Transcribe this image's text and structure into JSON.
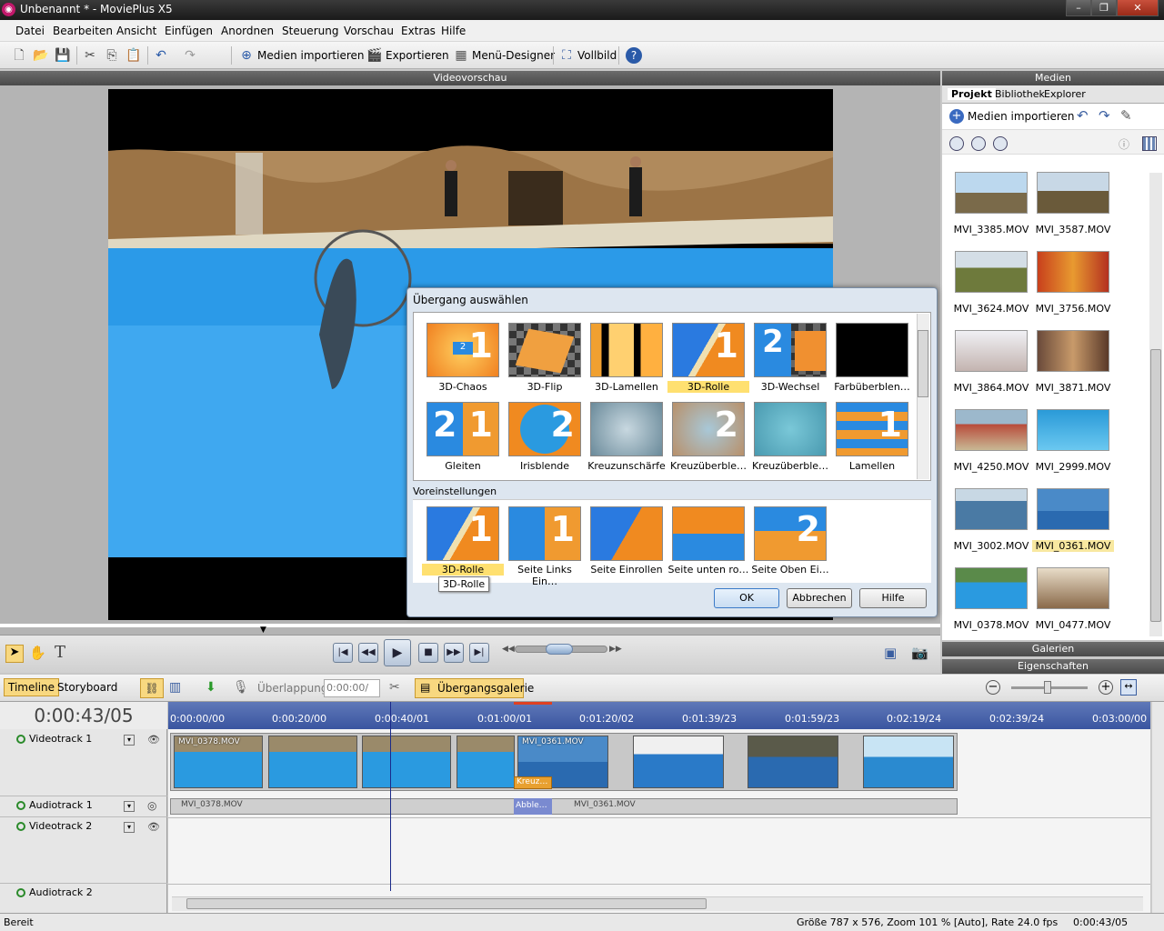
{
  "window": {
    "title": "Unbenannt * - MoviePlus X5"
  },
  "menu": [
    "Datei",
    "Bearbeiten",
    "Ansicht",
    "Einfügen",
    "Anordnen",
    "Steuerung",
    "Vorschau",
    "Extras",
    "Hilfe"
  ],
  "toolbar": {
    "import": "Medien importieren",
    "export": "Exportieren",
    "menu_designer": "Menü-Designer",
    "fullscreen": "Vollbild"
  },
  "preview": {
    "header": "Videovorschau"
  },
  "media": {
    "header": "Medien",
    "tabs": [
      "Projekt",
      "Bibliothek",
      "Explorer"
    ],
    "import": "Medien importieren",
    "items": [
      "MVI_3385.MOV",
      "MVI_3587.MOV",
      "MVI_3624.MOV",
      "MVI_3756.MOV",
      "MVI_3864.MOV",
      "MVI_3871.MOV",
      "MVI_4250.MOV",
      "MVI_2999.MOV",
      "MVI_3002.MOV",
      "MVI_0361.MOV",
      "MVI_0378.MOV",
      "MVI_0477.MOV"
    ],
    "galleries": "Galerien",
    "properties": "Eigenschaften"
  },
  "dialog": {
    "title": "Übergang auswählen",
    "transitions": [
      "3D-Chaos",
      "3D-Flip",
      "3D-Lamellen",
      "3D-Rolle",
      "3D-Wechsel",
      "Farbüberblen…",
      "Gleiten",
      "Irisblende",
      "Kreuzunschärfe",
      "Kreuzüberble…",
      "Kreuzüberble…",
      "Lamellen"
    ],
    "presets_header": "Voreinstellungen",
    "presets": [
      "3D-Rolle",
      "Seite Links Ein…",
      "Seite Einrollen",
      "Seite unten ro…",
      "Seite Oben Ei…"
    ],
    "tooltip": "3D-Rolle",
    "ok": "OK",
    "cancel": "Abbrechen",
    "help": "Hilfe"
  },
  "timeline": {
    "tab_timeline": "Timeline",
    "tab_storyboard": "Storyboard",
    "overlap_label": "Überlappung",
    "overlap_value": "0:00:00/",
    "gallery": "Übergangsgalerie",
    "current_time": "0:00:43/05",
    "ruler": [
      "0:00:00/00",
      "0:00:20/00",
      "0:00:40/01",
      "0:01:00/01",
      "0:01:20/02",
      "0:01:39/23",
      "0:01:59/23",
      "0:02:19/24",
      "0:02:39/24",
      "0:03:00/00"
    ],
    "tracks": [
      "Videotrack 1",
      "Audiotrack 1",
      "Videotrack 2",
      "Audiotrack 2"
    ],
    "video_clip_1": "MVI_0378.MOV",
    "video_clip_2": "MVI_0361.MOV",
    "transition_short": "Kreuz…",
    "audio_clip_1": "MVI_0378.MOV",
    "audio_transition": "Abble…",
    "audio_clip_2": "MVI_0361.MOV"
  },
  "status": {
    "ready": "Bereit",
    "info": "Größe 787 x 576, Zoom 101 % [Auto], Rate 24.0 fps",
    "time": "0:00:43/05"
  }
}
